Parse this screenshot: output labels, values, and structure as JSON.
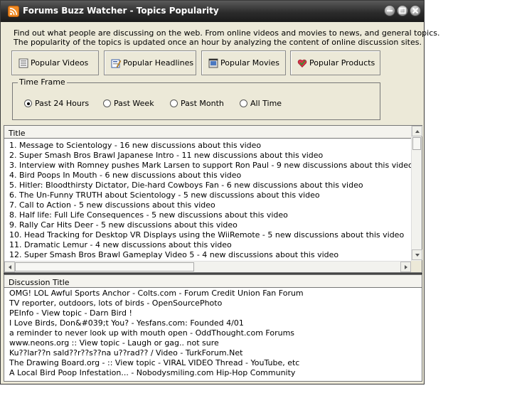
{
  "window": {
    "title": "Forums Buzz Watcher - Topics Popularity",
    "icon": "rss-icon"
  },
  "description": {
    "line1": "Find out what people are discussing on the web. From online videos and movies to news, and general topics.",
    "line2": "The popularity of the topics is updated once an hour by analyzing the content of online discussion sites."
  },
  "categories": [
    {
      "label": "Popular Videos",
      "icon": "video-icon"
    },
    {
      "label": "Popular Headlines",
      "icon": "headline-icon"
    },
    {
      "label": "Popular Movies",
      "icon": "movie-icon"
    },
    {
      "label": "Popular Products",
      "icon": "heart-icon"
    }
  ],
  "timeframe": {
    "legend": "Time Frame",
    "options": [
      "Past 24 Hours",
      "Past Week",
      "Past Month",
      "All Time"
    ],
    "selected": "Past 24 Hours"
  },
  "topics": {
    "header": "Title",
    "rows": [
      "1. Message to Scientology - 16 new discussions about this video",
      "2. Super Smash Bros Brawl Japanese Intro - 11 new discussions about this video",
      "3. Interview with Romney pushes Mark Larsen to support Ron Paul - 9 new discussions about this video",
      "4. Bird Poops In Mouth - 6 new discussions about this video",
      "5. Hitler: Bloodthirsty Dictator, Die-hard Cowboys Fan - 6 new discussions about this video",
      "6. The Un-Funny TRUTH about Scientology - 5 new discussions about this video",
      "7. Call to Action - 5 new discussions about this video",
      "8. Half life: Full Life Consequences - 5 new discussions about this video",
      "9. Rally Car Hits Deer - 5 new discussions about this video",
      "10. Head Tracking for Desktop VR Displays using the WiiRemote - 5 new discussions about this video",
      "11. Dramatic Lemur - 4 new discussions about this video",
      "12. Super Smash Bros Brawl Gameplay Video 5 - 4 new discussions about this video"
    ]
  },
  "discussions": {
    "header": "Discussion Title",
    "rows": [
      "OMG! LOL Awful Sports Anchor - Colts.com - Forum Credit Union Fan Forum",
      "TV reporter, outdoors, lots of birds - OpenSourcePhoto",
      "PEInfo - View topic - Darn Bird !",
      "I Love Birds, Don&#039;t You? - Yesfans.com: Founded 4/01",
      "a reminder to never look up with mouth open - OddThought.com Forums",
      "www.neons.org :: View topic - Laugh or gag.. not sure",
      "Ku??lar??n sald??r??s??na u??rad?? / Video - TurkForum.Net",
      "The Drawing Board.org - :: View topic - VIRAL VIDEO Thread - YouTube, etc",
      "A Local Bird Poop Infestation... - Nobodysmiling.com Hip-Hop Community"
    ]
  }
}
